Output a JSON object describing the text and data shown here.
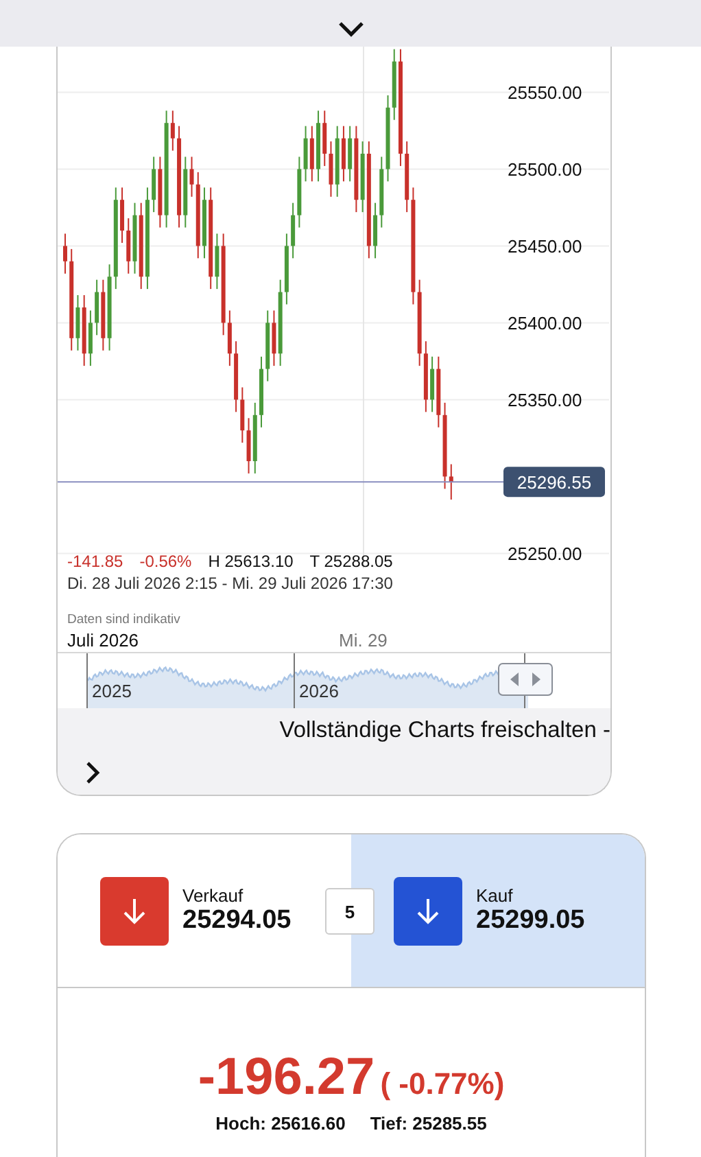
{
  "chart": {
    "chart_data": {
      "type": "candlestick",
      "grid": true,
      "ylim": [
        25240,
        25610
      ],
      "ref_lines": [
        {
          "axis": "y",
          "value": 25296.55,
          "label": "25296.55"
        }
      ],
      "yticks": [
        {
          "value": 25550,
          "label": "25550.00"
        },
        {
          "value": 25500,
          "label": "25500.00"
        },
        {
          "value": 25450,
          "label": "25450.00"
        },
        {
          "value": 25400,
          "label": "25400.00"
        },
        {
          "value": 25350,
          "label": "25350.00"
        },
        {
          "value": 25250,
          "label": "25250.00"
        }
      ],
      "ohlc": [
        [
          25450,
          25458,
          25432,
          25440
        ],
        [
          25440,
          25448,
          25382,
          25390
        ],
        [
          25390,
          25418,
          25382,
          25410
        ],
        [
          25410,
          25418,
          25372,
          25380
        ],
        [
          25380,
          25408,
          25372,
          25400
        ],
        [
          25400,
          25428,
          25392,
          25420
        ],
        [
          25420,
          25428,
          25382,
          25390
        ],
        [
          25390,
          25438,
          25382,
          25430
        ],
        [
          25430,
          25488,
          25422,
          25480
        ],
        [
          25480,
          25488,
          25452,
          25460
        ],
        [
          25460,
          25468,
          25432,
          25440
        ],
        [
          25440,
          25478,
          25432,
          25470
        ],
        [
          25470,
          25478,
          25422,
          25430
        ],
        [
          25430,
          25488,
          25422,
          25480
        ],
        [
          25480,
          25508,
          25472,
          25500
        ],
        [
          25500,
          25508,
          25462,
          25470
        ],
        [
          25470,
          25538,
          25462,
          25530
        ],
        [
          25530,
          25538,
          25512,
          25520
        ],
        [
          25520,
          25528,
          25462,
          25470
        ],
        [
          25470,
          25508,
          25462,
          25500
        ],
        [
          25500,
          25508,
          25482,
          25490
        ],
        [
          25490,
          25498,
          25442,
          25450
        ],
        [
          25450,
          25488,
          25442,
          25480
        ],
        [
          25480,
          25488,
          25422,
          25430
        ],
        [
          25430,
          25458,
          25422,
          25450
        ],
        [
          25450,
          25458,
          25392,
          25400
        ],
        [
          25400,
          25408,
          25372,
          25380
        ],
        [
          25380,
          25388,
          25342,
          25350
        ],
        [
          25350,
          25358,
          25322,
          25330
        ],
        [
          25330,
          25338,
          25302,
          25310
        ],
        [
          25310,
          25348,
          25302,
          25340
        ],
        [
          25340,
          25378,
          25332,
          25370
        ],
        [
          25370,
          25408,
          25362,
          25400
        ],
        [
          25400,
          25408,
          25372,
          25380
        ],
        [
          25380,
          25428,
          25372,
          25420
        ],
        [
          25420,
          25458,
          25412,
          25450
        ],
        [
          25450,
          25478,
          25442,
          25470
        ],
        [
          25470,
          25508,
          25462,
          25500
        ],
        [
          25500,
          25528,
          25492,
          25520
        ],
        [
          25520,
          25528,
          25492,
          25500
        ],
        [
          25500,
          25538,
          25492,
          25530
        ],
        [
          25530,
          25538,
          25502,
          25510
        ],
        [
          25510,
          25518,
          25482,
          25490
        ],
        [
          25490,
          25528,
          25482,
          25520
        ],
        [
          25520,
          25528,
          25492,
          25500
        ],
        [
          25500,
          25528,
          25492,
          25520
        ],
        [
          25520,
          25528,
          25472,
          25480
        ],
        [
          25480,
          25518,
          25472,
          25510
        ],
        [
          25510,
          25518,
          25442,
          25450
        ],
        [
          25450,
          25478,
          25442,
          25470
        ],
        [
          25470,
          25508,
          25462,
          25500
        ],
        [
          25500,
          25548,
          25492,
          25540
        ],
        [
          25540,
          25578,
          25532,
          25570
        ],
        [
          25570,
          25578,
          25502,
          25510
        ],
        [
          25510,
          25518,
          25472,
          25480
        ],
        [
          25480,
          25488,
          25412,
          25420
        ],
        [
          25420,
          25428,
          25372,
          25380
        ],
        [
          25380,
          25388,
          25342,
          25350
        ],
        [
          25350,
          25378,
          25342,
          25370
        ],
        [
          25370,
          25378,
          25332,
          25340
        ],
        [
          25340,
          25348,
          25292,
          25300
        ],
        [
          25300,
          25308,
          25285,
          25296.55
        ]
      ]
    },
    "change": "-141.85",
    "change_pct": "-0.56%",
    "high": "H 25613.10",
    "low": "T 25288.05",
    "range": "Di. 28 Juli 2026 2:15 - Mi. 29 Juli 2026 17:30",
    "disclaimer": "Daten sind indikativ",
    "period": "Juli 2026",
    "day": "Mi. 29",
    "navigator": {
      "years": [
        "2025",
        "2026"
      ]
    },
    "unlock": "Vollständige Charts freischalten -"
  },
  "trade": {
    "sides": [
      {
        "label": "Verkauf",
        "price": "25294.05",
        "color": "#d93a2e",
        "selected": false
      },
      {
        "label": "Kauf",
        "price": "25299.05",
        "color": "#2453d4",
        "selected": true
      }
    ],
    "spread": "5",
    "change": "-196.27",
    "change_pct": "( -0.77%)",
    "high": "Hoch: 25616.60",
    "low": "Tief: 25285.55"
  }
}
